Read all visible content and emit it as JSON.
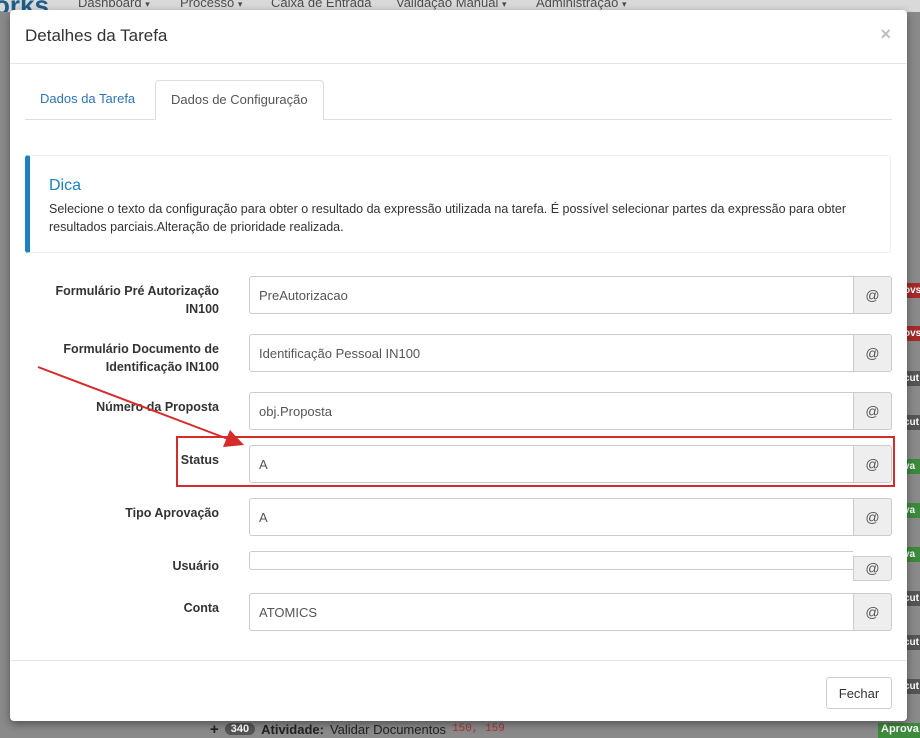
{
  "background": {
    "logo": "orks",
    "nav": [
      "Dashboard",
      "Processo",
      "Caixa de Entrada",
      "Validação Manual",
      "Administração"
    ],
    "nav_caret": "▾",
    "bottom_row": {
      "plus": "+",
      "count": "340",
      "label_bold": "Atividade:",
      "label": "Validar Documentos",
      "code": "150, 159"
    },
    "side_fragments_right": [
      "ovs",
      "ovs",
      "cut",
      "cut",
      "va",
      "va",
      "va",
      "cut",
      "cut",
      "cut"
    ],
    "bottom_badge": "Aprova"
  },
  "modal": {
    "title": "Detalhes da Tarefa",
    "close_icon": "×",
    "tabs": [
      {
        "label": "Dados da Tarefa"
      },
      {
        "label": "Dados de Configuração"
      }
    ],
    "tip": {
      "title": "Dica",
      "text": "Selecione o texto da configuração para obter o resultado da expressão utilizada na tarefa. É possível selecionar partes da expressão para obter resultados parciais.Alteração de prioridade realizada."
    },
    "addon_symbol": "@",
    "fields": [
      {
        "label": "Formulário Pré Autorização IN100",
        "value": "PreAutorizacao"
      },
      {
        "label": "Formulário Documento de Identificação IN100",
        "value": "Identificação Pessoal IN100"
      },
      {
        "label": "Número da Proposta",
        "value": "obj.Proposta"
      },
      {
        "label": "Status",
        "value": "A"
      },
      {
        "label": "Tipo Aprovação",
        "value": "A"
      },
      {
        "label": "Usuário",
        "value": ""
      },
      {
        "label": "Conta",
        "value": "ATOMICS"
      }
    ],
    "footer": {
      "close_label": "Fechar"
    },
    "annotation_color": "#d62b2b"
  }
}
